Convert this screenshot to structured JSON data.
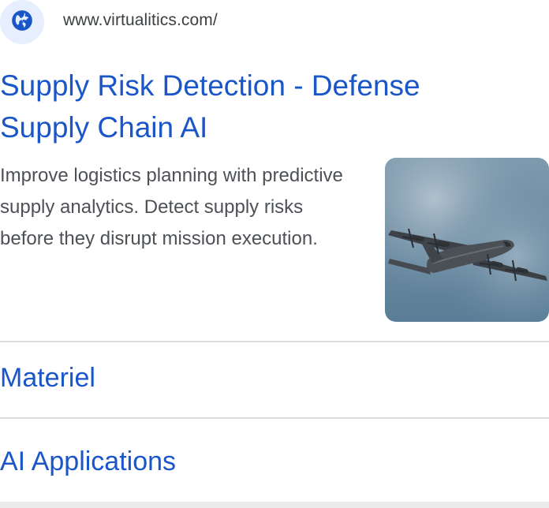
{
  "site": {
    "url": "www.virtualitics.com/",
    "favicon": "globe-icon"
  },
  "result": {
    "title": "Supply Risk Detection - Defense Supply Chain AI",
    "snippet": "Improve logistics planning with predictive supply analytics. Detect supply risks before they disrupt mission execution.",
    "thumbnail": "military-cargo-airplane-image"
  },
  "sitelinks": [
    {
      "label": "Materiel"
    },
    {
      "label": "AI Applications"
    }
  ],
  "colors": {
    "link": "#1a56c8",
    "text": "#4d5156",
    "url": "#3c4043",
    "favicon_bg": "#e7efff",
    "globe": "#1a56c8",
    "divider": "#dadce0"
  }
}
